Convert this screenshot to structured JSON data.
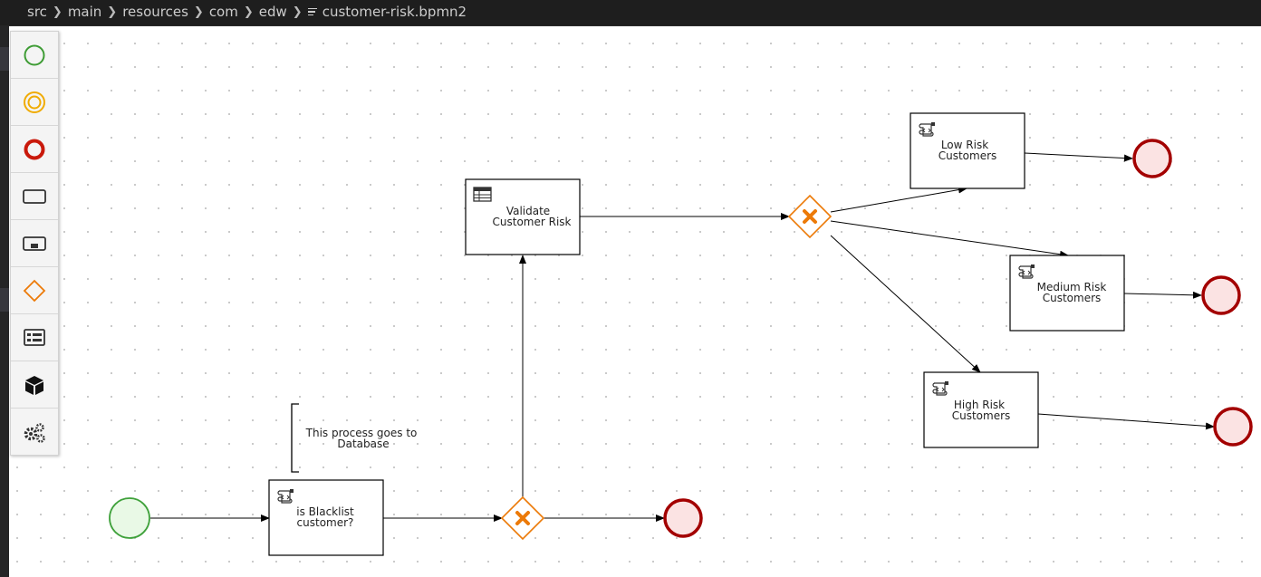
{
  "breadcrumb": {
    "items": [
      "src",
      "main",
      "resources",
      "com",
      "edw"
    ],
    "file": "customer-risk.bpmn2"
  },
  "palette": {
    "tools": [
      {
        "icon": "start-event-icon"
      },
      {
        "icon": "intermediate-event-icon"
      },
      {
        "icon": "end-event-icon"
      },
      {
        "icon": "task-icon"
      },
      {
        "icon": "subprocess-icon"
      },
      {
        "icon": "gateway-icon"
      },
      {
        "icon": "data-object-icon"
      },
      {
        "icon": "custom-task-icon"
      },
      {
        "icon": "service-tasks-icon"
      }
    ]
  },
  "diagram": {
    "annotation": {
      "line1": "This process goes to",
      "line2": "Database"
    },
    "tasks": {
      "blacklist": {
        "line1": "is Blacklist",
        "line2": "customer?",
        "kind": "script"
      },
      "validate": {
        "line1": "Validate",
        "line2": "Customer Risk",
        "kind": "business-rule"
      },
      "low": {
        "line1": "Low Risk",
        "line2": "Customers",
        "kind": "script"
      },
      "medium": {
        "line1": "Medium Risk",
        "line2": "Customers",
        "kind": "script"
      },
      "high": {
        "line1": "High Risk",
        "line2": "Customers",
        "kind": "script"
      }
    },
    "gateways": [
      "exclusive",
      "exclusive"
    ],
    "colors": {
      "start_fill": "#e9f9e6",
      "start_stroke": "#3fa13b",
      "end_fill": "#fbe3e3",
      "end_stroke": "#a30000",
      "gateway": "#ec7a08",
      "task_stroke": "#000000",
      "intermediate": "#f0ab00",
      "palette_end": "#c9190b"
    }
  }
}
